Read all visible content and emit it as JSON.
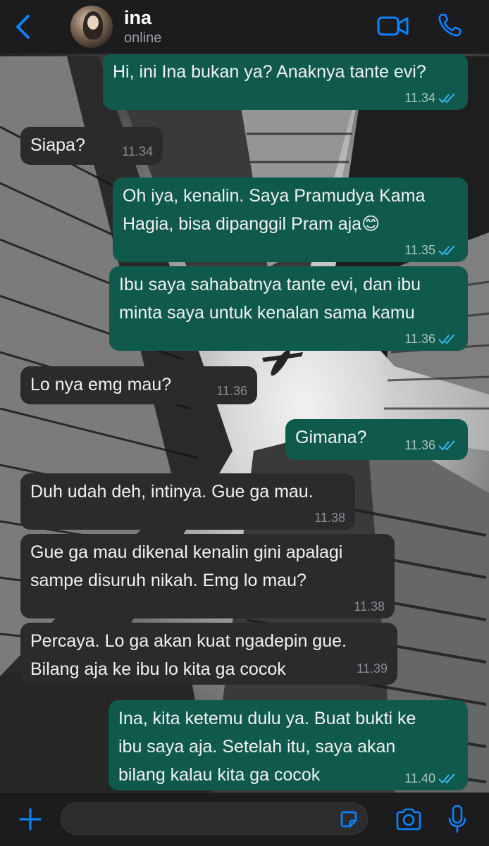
{
  "header": {
    "contact_name": "ina",
    "status": "online",
    "back_icon": "chevron-left-icon",
    "video_icon": "video-camera-icon",
    "call_icon": "phone-icon"
  },
  "colors": {
    "accent": "#0a84ff",
    "outgoing_bubble": "#0f5a4c",
    "incoming_bubble": "#2b2b2d",
    "read_ticks": "#34b7f1"
  },
  "messages": [
    {
      "direction": "outgoing",
      "lines": [
        "Hi, ini Ina bukan ya? Anaknya tante evi?"
      ],
      "time": "11.34",
      "read": true
    },
    {
      "direction": "incoming",
      "lines": [
        "Siapa?"
      ],
      "time": "11.34"
    },
    {
      "direction": "outgoing",
      "lines": [
        "Oh iya, kenalin. Saya Pramudya Kama",
        "Hagia, bisa dipanggil Pram aja😊"
      ],
      "time": "11.35",
      "read": true
    },
    {
      "direction": "outgoing",
      "lines": [
        "Ibu saya sahabatnya tante evi, dan ibu",
        "minta saya untuk kenalan sama kamu"
      ],
      "time": "11.36",
      "read": true
    },
    {
      "direction": "incoming",
      "lines": [
        "Lo nya emg mau?"
      ],
      "time": "11.36"
    },
    {
      "direction": "outgoing",
      "lines": [
        "Gimana?"
      ],
      "time": "11.36",
      "read": true
    },
    {
      "direction": "incoming",
      "lines": [
        "Duh udah deh, intinya. Gue ga mau."
      ],
      "time": "11.38"
    },
    {
      "direction": "incoming",
      "lines": [
        "Gue ga mau dikenal kenalin gini apalagi",
        "sampe disuruh nikah. Emg lo mau?"
      ],
      "time": "11.38"
    },
    {
      "direction": "incoming",
      "lines": [
        "Percaya. Lo ga akan kuat ngadepin gue.",
        "Bilang aja ke ibu lo kita ga cocok"
      ],
      "time": "11.39"
    },
    {
      "direction": "outgoing",
      "lines": [
        "Ina, kita ketemu dulu ya. Buat bukti ke",
        "ibu saya aja. Setelah itu, saya akan",
        "bilang kalau kita ga cocok"
      ],
      "time": "11.40",
      "read": true
    }
  ],
  "footer": {
    "attach_icon": "plus-icon",
    "input_placeholder": "",
    "sticker_icon": "sticker-icon",
    "camera_icon": "camera-icon",
    "mic_icon": "microphone-icon"
  }
}
